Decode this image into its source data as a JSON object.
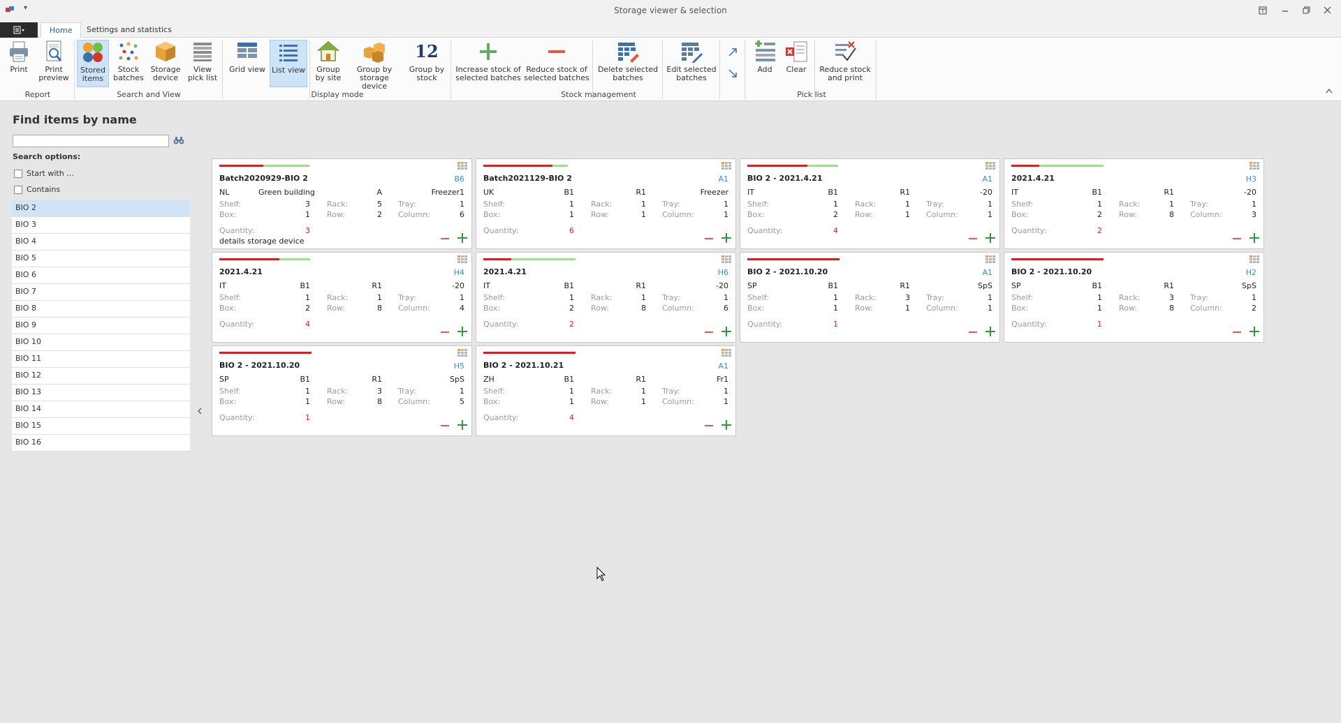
{
  "window": {
    "title": "Storage viewer & selection",
    "qat": "▾"
  },
  "tabs": [
    {
      "label": "Home",
      "active": true
    },
    {
      "label": "Settings and statistics",
      "active": false
    }
  ],
  "ribbon": {
    "groups": {
      "report": "Report",
      "search_view": "Search and View",
      "display_mode": "Display mode",
      "stock_management": "Stock management",
      "pick_list": "Pick list"
    },
    "buttons": {
      "print": [
        "Print",
        ""
      ],
      "print_preview": [
        "Print",
        "preview"
      ],
      "stored_items": [
        "Stored",
        "items"
      ],
      "stock_batches": [
        "Stock",
        "batches"
      ],
      "storage_device": [
        "Storage",
        "device"
      ],
      "view_pick_list": [
        "View",
        "pick list"
      ],
      "grid_view": [
        "Grid view",
        ""
      ],
      "list_view": [
        "List view",
        ""
      ],
      "group_site": [
        "Group",
        "by site"
      ],
      "group_storage": [
        "Group by",
        "storage device"
      ],
      "group_stock": [
        "Group by",
        "stock"
      ],
      "increase": [
        "Increase stock of",
        "selected batches"
      ],
      "reduce": [
        "Reduce stock of",
        "selected batches"
      ],
      "delete": [
        "Delete selected",
        "batches"
      ],
      "edit": [
        "Edit selected",
        "batches"
      ],
      "add": [
        "Add",
        ""
      ],
      "clear": [
        "Clear",
        ""
      ],
      "reduce_print": [
        "Reduce stock",
        "and print"
      ]
    },
    "group_by_stock_number": "12"
  },
  "search": {
    "title": "Find items by name",
    "value": "",
    "options_title": "Search options:",
    "start_with": "Start with ...",
    "contains": "Contains"
  },
  "items": [
    "BIO 2",
    "BIO 3",
    "BIO 4",
    "BIO 5",
    "BIO 6",
    "BIO 7",
    "BIO 8",
    "BIO 9",
    "BIO 10",
    "BIO 11",
    "BIO 12",
    "BIO 13",
    "BIO 14",
    "BIO 15",
    "BIO 16"
  ],
  "labels": {
    "shelf": "Shelf:",
    "box": "Box:",
    "rack": "Rack:",
    "row": "Row:",
    "tray": "Tray:",
    "column": "Column:",
    "quantity": "Quantity:"
  },
  "cards": [
    {
      "name": "Batch2020929-BIO 2",
      "loc": "B6",
      "site": "NL",
      "building": "Green building",
      "area": "A",
      "device": "Freezer1",
      "shelf": "3",
      "rack": "5",
      "tray": "1",
      "box": "1",
      "row": "2",
      "column": "6",
      "qty": "3",
      "detail": "details storage device",
      "fill_red": 0.48,
      "fill_green": 0.5
    },
    {
      "name": "Batch2021129-BIO 2",
      "loc": "A1",
      "site": "UK",
      "building": "",
      "area": "B1",
      "area2": "R1",
      "device": "Freezer",
      "shelf": "1",
      "rack": "1",
      "tray": "1",
      "box": "1",
      "row": "1",
      "column": "1",
      "qty": "6",
      "detail": "",
      "fill_red": 0.75,
      "fill_green": 0.17
    },
    {
      "name": "BIO 2 - 2021.4.21",
      "loc": "A1",
      "site": "IT",
      "building": "",
      "area": "B1",
      "area2": "R1",
      "device": "-20",
      "shelf": "1",
      "rack": "1",
      "tray": "1",
      "box": "2",
      "row": "1",
      "column": "1",
      "qty": "4",
      "detail": "",
      "fill_red": 0.65,
      "fill_green": 0.33
    },
    {
      "name": "2021.4.21",
      "loc": "H3",
      "site": "IT",
      "building": "",
      "area": "B1",
      "area2": "R1",
      "device": "-20",
      "shelf": "1",
      "rack": "1",
      "tray": "1",
      "box": "2",
      "row": "8",
      "column": "3",
      "qty": "2",
      "detail": "",
      "fill_red": 0.3,
      "fill_green": 0.7
    },
    {
      "name": "2021.4.21",
      "loc": "H4",
      "site": "IT",
      "building": "",
      "area": "B1",
      "area2": "R1",
      "device": "-20",
      "shelf": "1",
      "rack": "1",
      "tray": "1",
      "box": "2",
      "row": "8",
      "column": "4",
      "qty": "4",
      "detail": "",
      "fill_red": 0.65,
      "fill_green": 0.33
    },
    {
      "name": "2021.4.21",
      "loc": "H6",
      "site": "IT",
      "building": "",
      "area": "B1",
      "area2": "R1",
      "device": "-20",
      "shelf": "1",
      "rack": "1",
      "tray": "1",
      "box": "2",
      "row": "8",
      "column": "6",
      "qty": "2",
      "detail": "",
      "fill_red": 0.3,
      "fill_green": 0.7
    },
    {
      "name": "BIO 2 - 2021.10.20",
      "loc": "A1",
      "site": "SP",
      "building": "",
      "area": "B1",
      "area2": "R1",
      "device": "SpS",
      "shelf": "1",
      "rack": "3",
      "tray": "1",
      "box": "1",
      "row": "1",
      "column": "1",
      "qty": "1",
      "detail": "",
      "fill_red": 1.0,
      "fill_green": 0.0
    },
    {
      "name": "BIO 2 - 2021.10.20",
      "loc": "H2",
      "site": "SP",
      "building": "",
      "area": "B1",
      "area2": "R1",
      "device": "SpS",
      "shelf": "1",
      "rack": "3",
      "tray": "1",
      "box": "1",
      "row": "8",
      "column": "2",
      "qty": "1",
      "detail": "",
      "fill_red": 1.0,
      "fill_green": 0.0
    },
    {
      "name": "BIO 2 - 2021.10.20",
      "loc": "H5",
      "site": "SP",
      "building": "",
      "area": "B1",
      "area2": "R1",
      "device": "SpS",
      "shelf": "1",
      "rack": "3",
      "tray": "1",
      "box": "1",
      "row": "8",
      "column": "5",
      "qty": "1",
      "detail": "",
      "fill_red": 1.0,
      "fill_green": 0.0
    },
    {
      "name": "BIO 2 - 2021.10.21",
      "loc": "A1",
      "site": "ZH",
      "building": "",
      "area": "B1",
      "area2": "R1",
      "device": "Fr1",
      "shelf": "1",
      "rack": "1",
      "tray": "1",
      "box": "1",
      "row": "1",
      "column": "1",
      "qty": "4",
      "detail": "",
      "fill_red": 1.0,
      "fill_green": 0.0
    }
  ],
  "colors": {
    "accent": "#1f5fa8",
    "location": "#2e8fd6",
    "quantity": "#e01c1c",
    "selected": "#cde3f7"
  }
}
